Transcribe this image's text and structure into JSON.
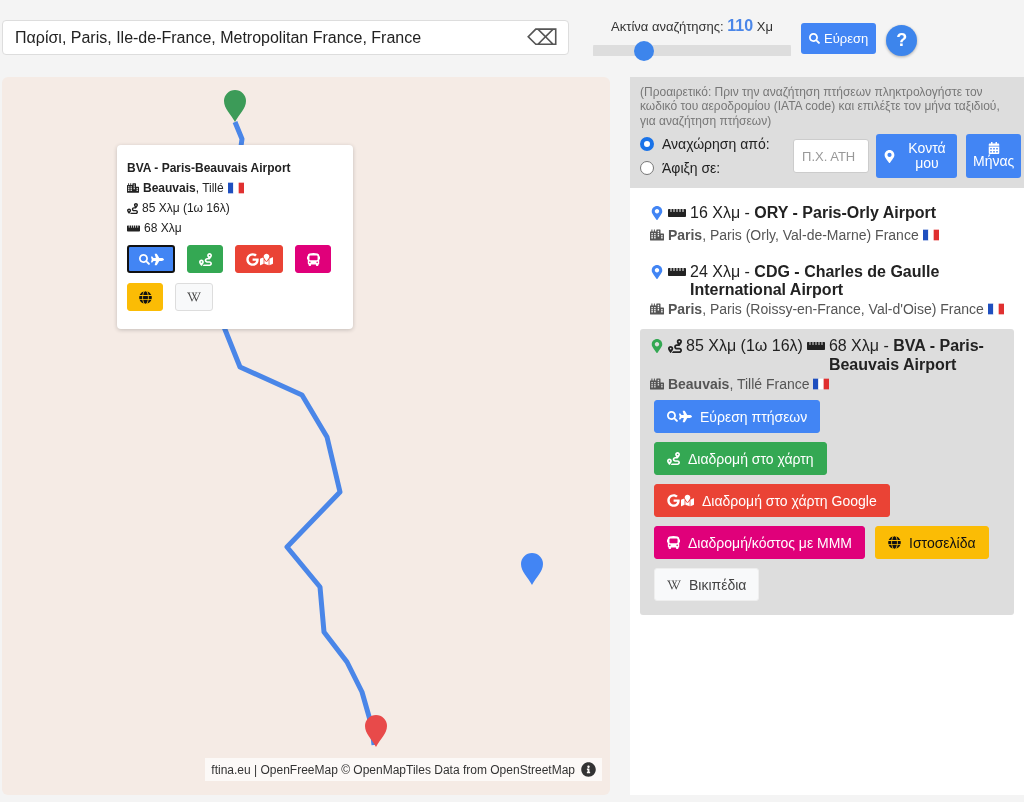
{
  "search": {
    "value": "Παρίσι, Paris, Ile-de-France, Metropolitan France, France",
    "clear_symbol": "⌫"
  },
  "radius": {
    "label": "Ακτίνα αναζήτησης:",
    "value": "110",
    "unit": "Χμ",
    "level": 0.26
  },
  "find_button": "Εύρεση",
  "help_button": "?",
  "map": {
    "popup": {
      "title": "BVA - Paris-Beauvais Airport",
      "city": "**Beauvais**, Tillé",
      "drive": "85 Χλμ (1ω 16λ)",
      "distance": "68 Χλμ",
      "buttons": [
        {
          "kind": "flights",
          "focused": true
        },
        {
          "kind": "route",
          "focused": false
        },
        {
          "kind": "google",
          "focused": false
        },
        {
          "kind": "transit",
          "focused": false
        },
        {
          "kind": "website",
          "focused": false
        },
        {
          "kind": "wiki",
          "focused": false
        }
      ]
    },
    "attribution": "ftina.eu | OpenFreeMap © OpenMapTiles Data from OpenStreetMap"
  },
  "flight_form": {
    "note": "(Προαιρετικό: Πριν την αναζήτηση πτήσεων πληκτρολογήστε τον κωδικό του αεροδρομίου (IATA code) και επιλέξτε τον μήνα ταξιδιού, για αναζήτηση πτήσεων)",
    "options": [
      {
        "label": "Αναχώρηση από:",
        "selected": true
      },
      {
        "label": "Άφιξη σε:",
        "selected": false
      }
    ],
    "placeholder": "Π.Χ. ΑΤΗ",
    "buttons": [
      {
        "kind": "near",
        "label": "Κοντά μου"
      },
      {
        "kind": "month",
        "label": "Μήνας"
      }
    ]
  },
  "airports": [
    {
      "selected": false,
      "line": "16 Χλμ - **ORY - Paris-Orly Airport**",
      "location": "**Paris**, Paris (Orly, Val-de-Marne) France"
    },
    {
      "selected": false,
      "line": "24 Χλμ - **CDG - Charles de Gaulle International Airport**",
      "location": "**Paris**, Paris (Roissy-en-France, Val-d'Oise) France"
    },
    {
      "selected": true,
      "drive": "85 Χλμ (1ω 16λ)",
      "line": "68 Χλμ - **BVA - Paris-Beauvais Airport**",
      "location": "**Beauvais**, Tillé France",
      "buttons": [
        {
          "kind": "flights",
          "label": "Εύρεση πτήσεων"
        },
        {
          "kind": "route",
          "label": "Διαδρομή στο χάρτη"
        },
        {
          "kind": "google",
          "label": "Διαδρομή στο χάρτη Google"
        },
        {
          "kind": "transit",
          "label": "Διαδρομή/κόστος με ΜΜΜ"
        },
        {
          "kind": "website",
          "label": "Ιστοσελίδα"
        },
        {
          "kind": "wiki",
          "label": "Βικιπέδια"
        }
      ]
    }
  ]
}
